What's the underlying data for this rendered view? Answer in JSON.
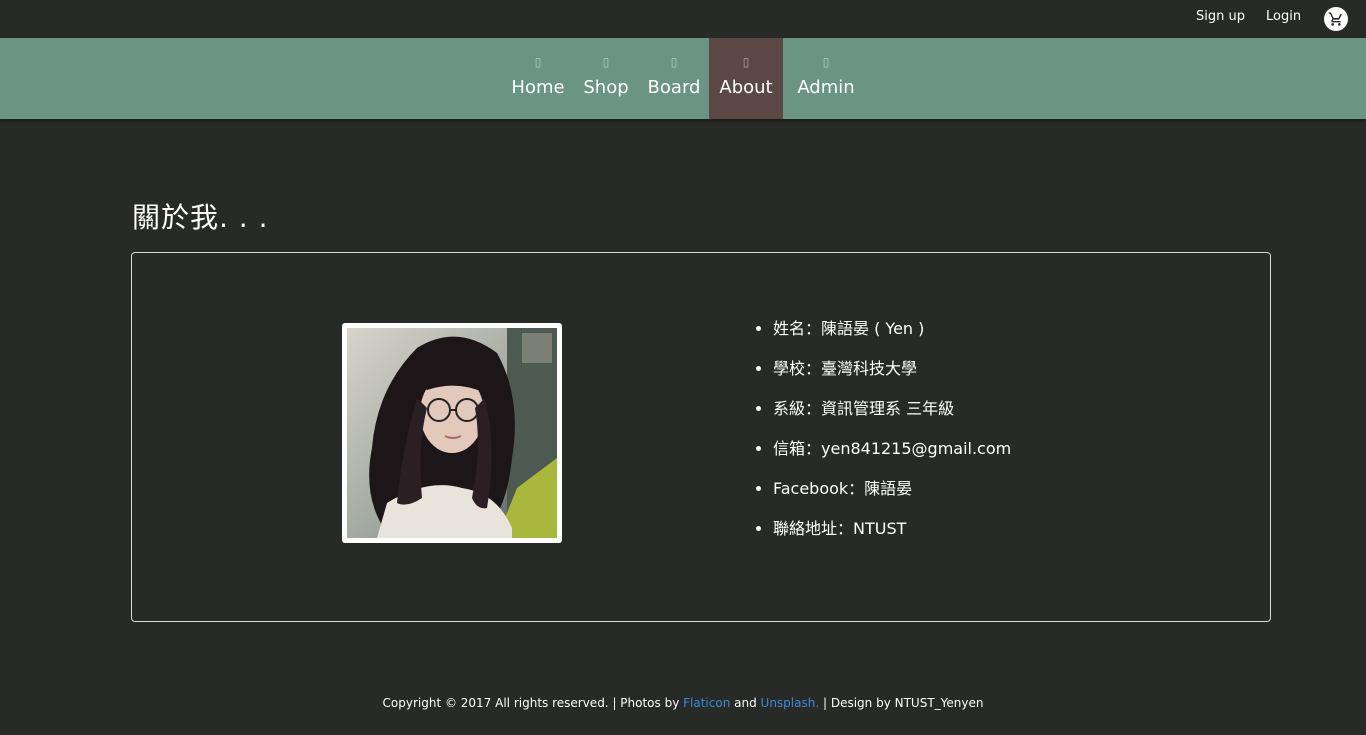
{
  "topbar": {
    "signup_label": "Sign up",
    "login_label": "Login",
    "cart_icon": "cart-icon"
  },
  "nav": {
    "items": [
      {
        "label": "Home",
        "icon": "home-icon"
      },
      {
        "label": "Shop",
        "icon": "shop-icon"
      },
      {
        "label": "Board",
        "icon": "board-icon"
      },
      {
        "label": "About",
        "icon": "about-icon",
        "active": true
      },
      {
        "label": "Admin",
        "icon": "admin-icon"
      }
    ]
  },
  "page": {
    "title": "關於我. . ."
  },
  "profile": {
    "photo_alt": "profile-photo",
    "details": [
      "姓名：陳語晏 ( Yen )",
      "學校：臺灣科技大學",
      "系級：資訊管理系 三年級",
      "信箱：yen841215@gmail.com",
      "Facebook：陳語晏",
      "聯絡地址：NTUST"
    ]
  },
  "footer": {
    "prefix": "Copyright © 2017 All rights reserved. | Photos by ",
    "flaticon_link": "Flaticon",
    "and": " and ",
    "unsplash_link": "Unsplash.",
    "suffix": " | Design by NTUST_Yenyen"
  },
  "colors": {
    "background": "#272a26",
    "nav": "#6a9484",
    "nav_active": "#5b4845",
    "link": "#3a8ad6"
  }
}
